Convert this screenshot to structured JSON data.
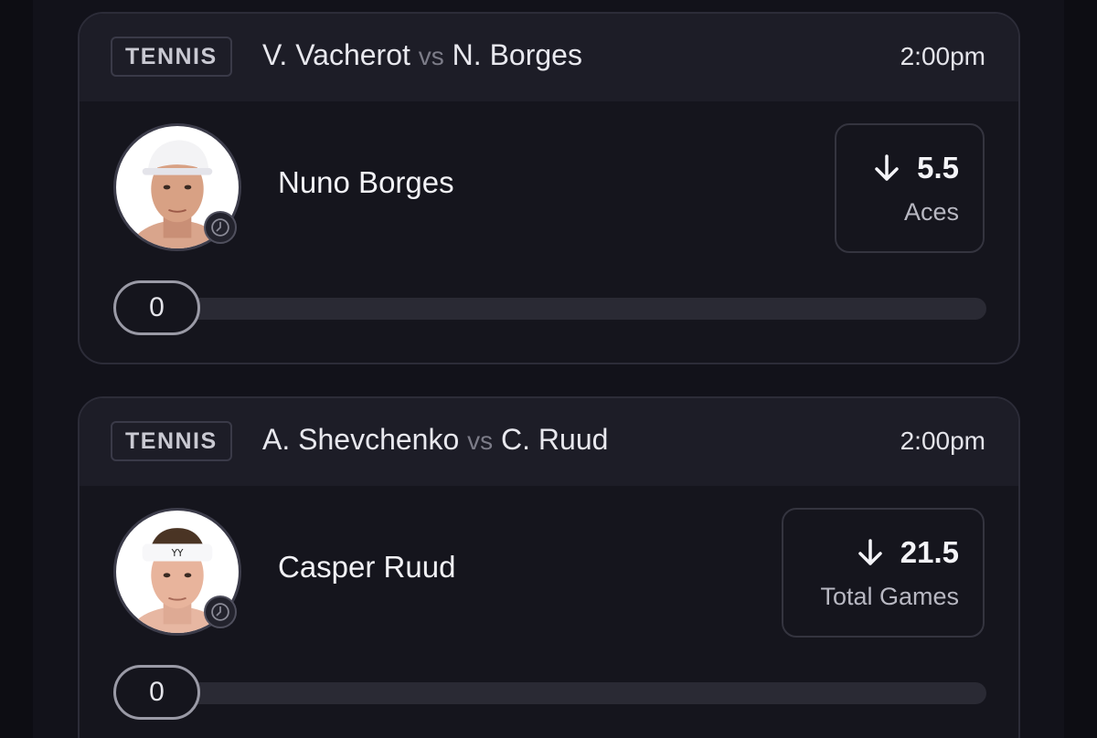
{
  "picks": [
    {
      "sport": "TENNIS",
      "player_a": "V. Vacherot",
      "vs": "vs",
      "player_b": "N. Borges",
      "time": "2:00pm",
      "selected_player": "Nuno Borges",
      "direction": "down",
      "line": "5.5",
      "stat": "Aces",
      "progress_value": "0"
    },
    {
      "sport": "TENNIS",
      "player_a": "A. Shevchenko",
      "vs": "vs",
      "player_b": "C. Ruud",
      "time": "2:00pm",
      "selected_player": "Casper Ruud",
      "direction": "down",
      "line": "21.5",
      "stat": "Total Games",
      "progress_value": "0"
    }
  ],
  "icons": {
    "direction": "arrow-down-icon",
    "status": "clock-icon"
  },
  "colors": {
    "background": "#0d0d13",
    "card": "#15151d",
    "card_header": "#1d1d27",
    "text": "#f2f2f6",
    "muted": "#7c7c88"
  }
}
